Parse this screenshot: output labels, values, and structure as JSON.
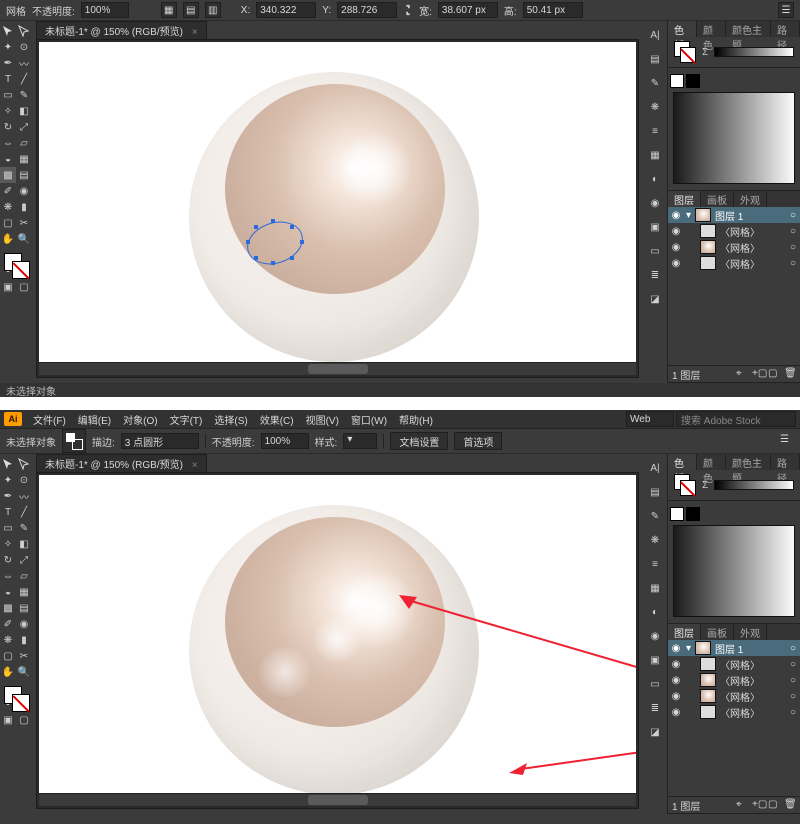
{
  "top": {
    "tab_title": "未标题-1* @ 150% (RGB/预览)",
    "status_text": "未选择对象",
    "mesh_label": "网格",
    "opacity_label": "不透明度:",
    "opacity_value": "100%",
    "x_label": "宽:",
    "x_value": "340.322",
    "y_label": "高:",
    "y_value": "288.726",
    "w_value": "38.607 px",
    "h_value": "50.41 px"
  },
  "bottom": {
    "tab_title": "未标题-1* @ 150% (RGB/预览)",
    "status_text": "未选择对象",
    "stroke_label": "描边:",
    "stroke_value": "3 点圆形",
    "opacity_label": "不透明度:",
    "opacity_value": "100%",
    "style_label": "样式:",
    "btn_docsetup": "文档设置",
    "btn_prefs": "首选项",
    "essentials": "Web",
    "search_placeholder": "搜索 Adobe Stock"
  },
  "menus": {
    "items": [
      "文件(F)",
      "编辑(E)",
      "对象(O)",
      "文字(T)",
      "选择(S)",
      "效果(C)",
      "视图(V)",
      "窗口(W)",
      "帮助(H)"
    ]
  },
  "panels": {
    "tabs_color": [
      "色板",
      "颜色",
      "颜色主题",
      "路径"
    ],
    "tabs_layers": [
      "图层",
      "画板",
      "外观"
    ],
    "layer_group": "图层 1",
    "sublayers": [
      "〈网格〉",
      "〈网格〉",
      "〈网格〉",
      "〈网格〉"
    ],
    "layer_count": "1 图层"
  },
  "logo_text": "Ai"
}
